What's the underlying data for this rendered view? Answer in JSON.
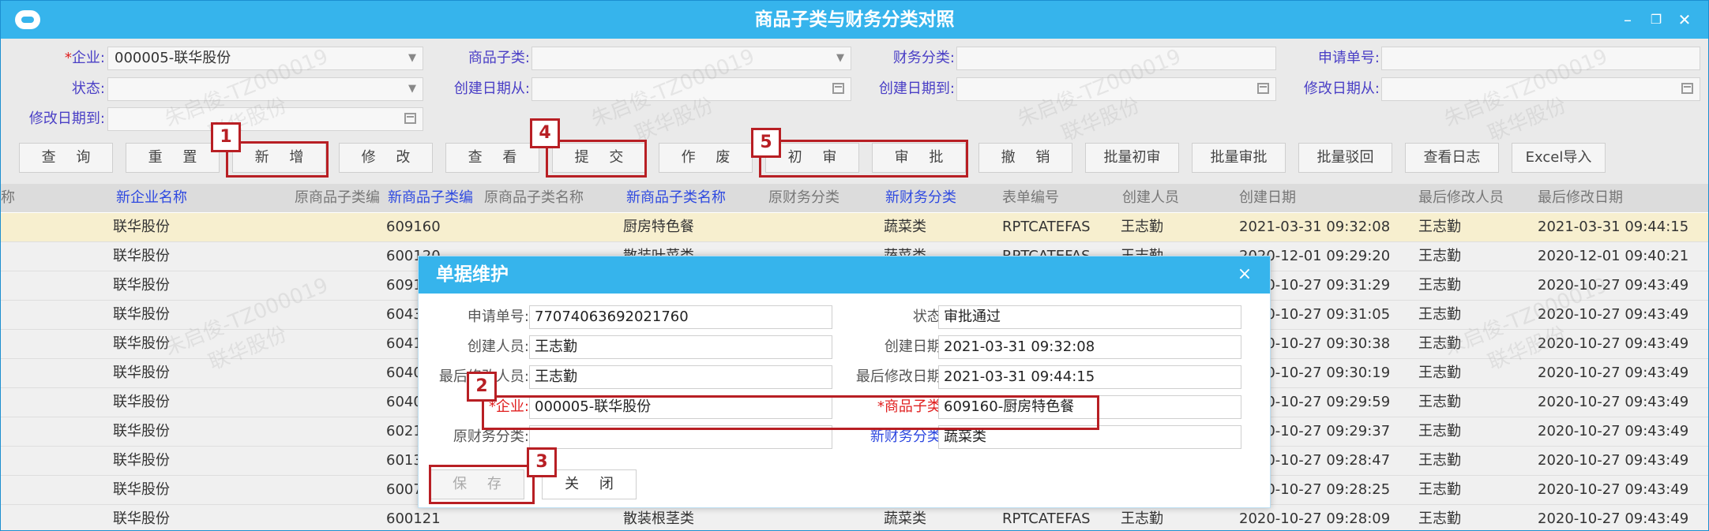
{
  "window": {
    "title": "商品子类与财务分类对照",
    "minimize_icon": "minimize-icon",
    "restore_icon": "restore-icon",
    "close_icon": "close-icon"
  },
  "filters": {
    "company_label": "企业:",
    "company_required": "*",
    "company_value": "000005-联华股份",
    "subcat_label": "商品子类:",
    "fincat_label": "财务分类:",
    "reqno_label": "申请单号:",
    "status_label": "状态:",
    "created_from_label": "创建日期从:",
    "created_to_label": "创建日期到:",
    "modified_from_label": "修改日期从:",
    "modified_to_label": "修改日期到:"
  },
  "toolbar": {
    "query": "查 询",
    "reset": "重 置",
    "add": "新 增",
    "edit": "修 改",
    "view": "查 看",
    "submit": "提 交",
    "void": "作 废",
    "first_review": "初 审",
    "approve": "审 批",
    "revoke": "撤 销",
    "batch_first_review": "批量初审",
    "batch_approve": "批量审批",
    "batch_reject": "批量驳回",
    "view_log": "查看日志",
    "excel_import": "Excel导入"
  },
  "grid": {
    "headers": [
      "称",
      "新企业名称",
      "原商品子类编",
      "新商品子类编",
      "原商品子类名称",
      "新商品子类名称",
      "原财务分类",
      "新财务分类",
      "表单编号",
      "创建人员",
      "创建日期",
      "最后修改人员",
      "最后修改日期"
    ],
    "rows": [
      [
        "联华股份",
        "609160",
        "厨房特色餐",
        "蔬菜类",
        "RPTCATEFAS",
        "王志勤",
        "2021-03-31 09:32:08",
        "王志勤",
        "2021-03-31 09:44:15"
      ],
      [
        "联华股份",
        "600120",
        "散装叶菜类",
        "蔬菜类",
        "RPTCATEFAS",
        "王志勤",
        "2020-12-01 09:29:20",
        "王志勤",
        "2020-12-01 09:40:21"
      ],
      [
        "联华股份",
        "6091",
        "",
        "",
        "",
        "",
        "2020-10-27 09:31:29",
        "王志勤",
        "2020-10-27 09:43:49"
      ],
      [
        "联华股份",
        "6043",
        "",
        "",
        "",
        "",
        "2020-10-27 09:31:05",
        "王志勤",
        "2020-10-27 09:43:49"
      ],
      [
        "联华股份",
        "6041",
        "",
        "",
        "",
        "",
        "2020-10-27 09:30:38",
        "王志勤",
        "2020-10-27 09:43:49"
      ],
      [
        "联华股份",
        "6040",
        "",
        "",
        "",
        "",
        "2020-10-27 09:30:19",
        "王志勤",
        "2020-10-27 09:43:49"
      ],
      [
        "联华股份",
        "6040",
        "",
        "",
        "",
        "",
        "2020-10-27 09:29:59",
        "王志勤",
        "2020-10-27 09:43:49"
      ],
      [
        "联华股份",
        "6021",
        "",
        "",
        "",
        "",
        "2020-10-27 09:29:37",
        "王志勤",
        "2020-10-27 09:43:49"
      ],
      [
        "联华股份",
        "6013",
        "",
        "",
        "",
        "",
        "2020-10-27 09:28:47",
        "王志勤",
        "2020-10-27 09:43:49"
      ],
      [
        "联华股份",
        "6007",
        "",
        "",
        "",
        "",
        "2020-10-27 09:28:25",
        "王志勤",
        "2020-10-27 09:43:49"
      ],
      [
        "联华股份",
        "600121",
        "散装根茎类",
        "蔬菜类",
        "RPTCATEFAS",
        "王志勤",
        "2020-10-27 09:28:09",
        "王志勤",
        "2020-10-27 09:43:49"
      ]
    ]
  },
  "watermark": {
    "line1": "朱启俊-TZ000019",
    "line2": "联华股份"
  },
  "dialog": {
    "title": "单据维护",
    "close": "×",
    "reqno_label": "申请单号:",
    "reqno_value": "77074063692021760",
    "status_label": "状态:",
    "status_value": "审批通过",
    "creator_label": "创建人员:",
    "creator_value": "王志勤",
    "created_label": "创建日期:",
    "created_value": "2021-03-31 09:32:08",
    "modifier_label": "最后修改人员:",
    "modifier_value": "王志勤",
    "modified_label": "最后修改日期:",
    "modified_value": "2021-03-31 09:44:15",
    "company_label": "*企业:",
    "company_value": "000005-联华股份",
    "subcat_label": "*商品子类:",
    "subcat_value": "609160-厨房特色餐",
    "old_fincat_label": "原财务分类:",
    "old_fincat_value": "",
    "new_fincat_label": "新财务分类:",
    "new_fincat_value": "蔬菜类",
    "save": "保 存",
    "close_btn": "关 闭"
  },
  "annotations": [
    "1",
    "2",
    "3",
    "4",
    "5"
  ],
  "colors": {
    "titlebar": "#36b4ec",
    "highlight": "#b81f24",
    "label_blue": "#2f4ae0",
    "required_red": "#e02020",
    "selected_row": "#f7efcf"
  }
}
